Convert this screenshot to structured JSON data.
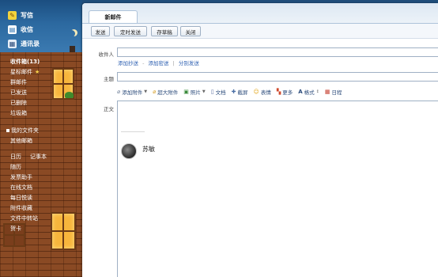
{
  "sidebar": {
    "nav": {
      "compose": "写信",
      "inbox": "收信",
      "contacts": "通讯录"
    },
    "folders": {
      "inbox": "收件箱(13)",
      "starred": "星标邮件",
      "starred_icon": "★",
      "group": "群邮件",
      "sent": "已发送",
      "deleted": "已删除",
      "spam": "垃圾箱"
    },
    "my_folders": "我的文件夹",
    "other_mail": "其他邮箱",
    "tools": {
      "calendar": "日历",
      "notes": "记事本",
      "diary": "随历",
      "send_helper": "发票助手",
      "online_docs": "在线文档",
      "daily_read": "每日悦读",
      "attachments": "附件收藏",
      "file_transfer": "文件中转站",
      "card": "贺卡"
    }
  },
  "compose": {
    "tab_title": "新邮件",
    "toolbar": {
      "send": "发送",
      "scheduled": "定时发送",
      "save_draft": "存草稿",
      "close": "关闭"
    },
    "to_label": "收件人",
    "to_value": "",
    "to_links": {
      "cc": "添加抄送",
      "dash": "-",
      "bcc": "添加密送",
      "separate": "分别发送"
    },
    "subject_label": "主题",
    "subject_value": "",
    "format_bar": {
      "attach": "添加附件",
      "big_attach": "超大附件",
      "photo": "照片",
      "doc": "文档",
      "screenshot": "截屏",
      "emoji": "表情",
      "more": "更多",
      "format": "格式",
      "calendar": "日程"
    },
    "body_label": "正文",
    "signature_name": "苏敏"
  }
}
